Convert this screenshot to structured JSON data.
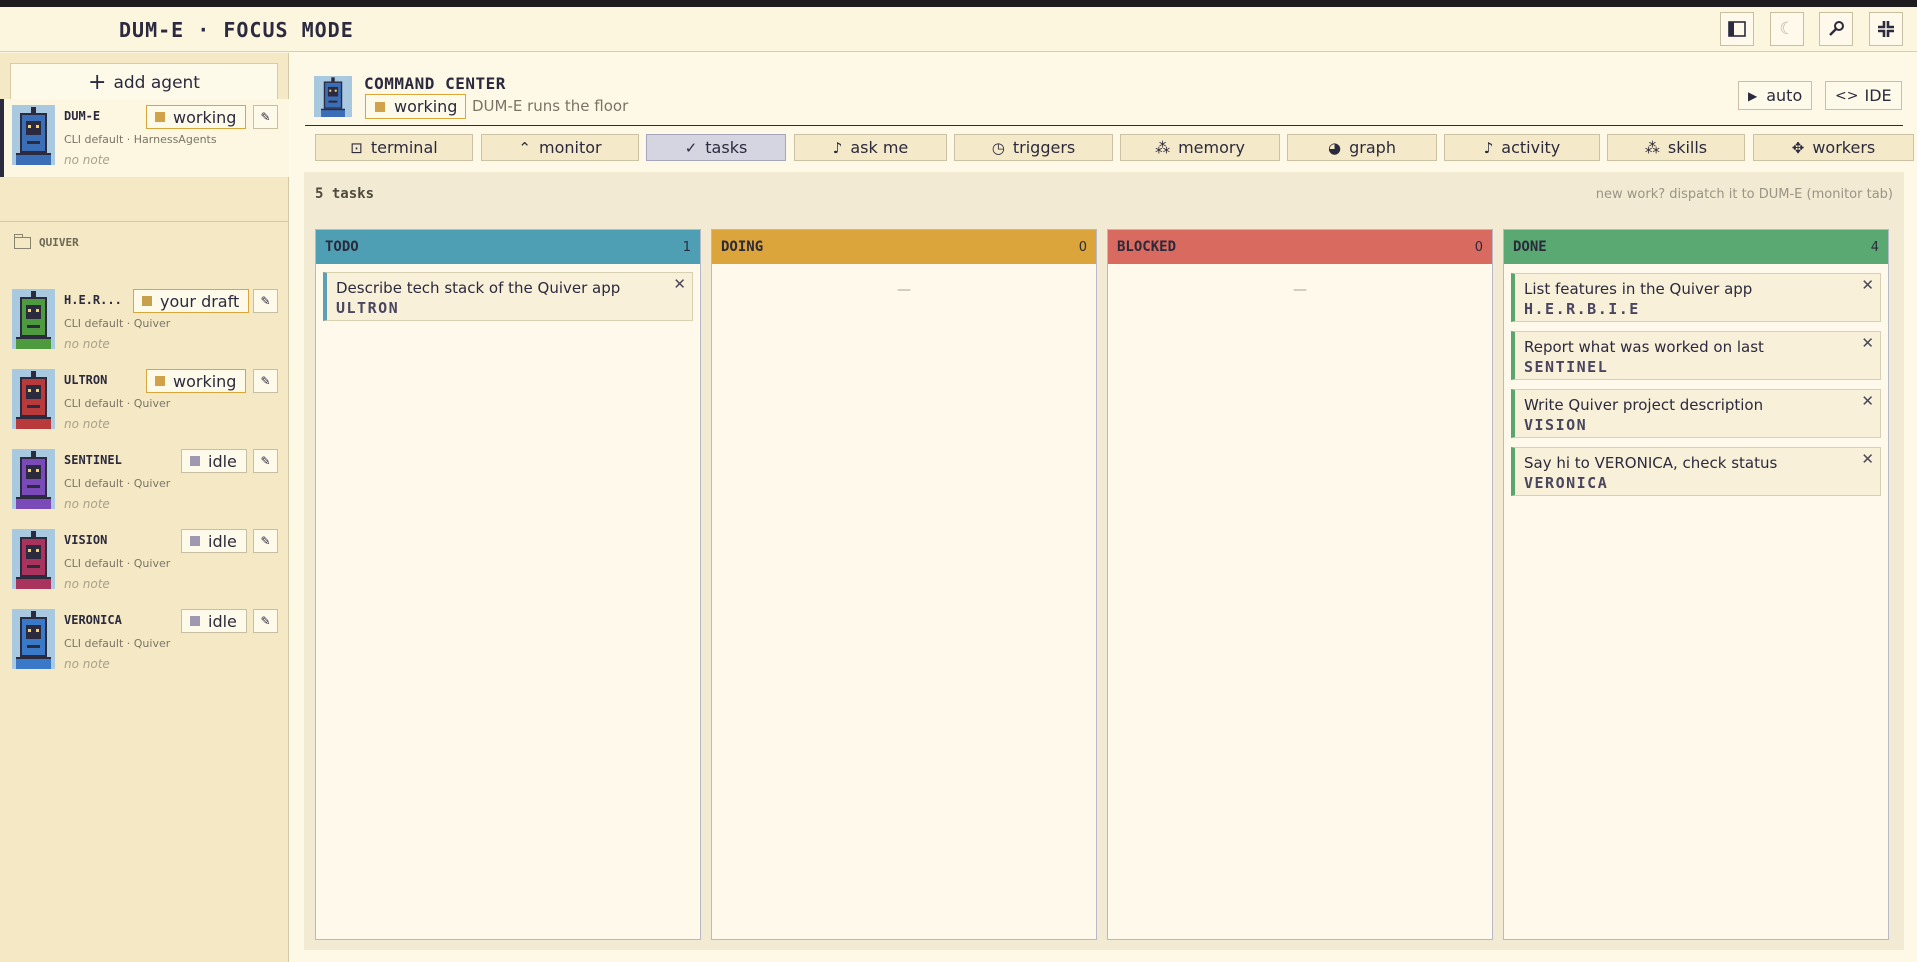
{
  "app": {
    "title": "DUM-E · FOCUS MODE"
  },
  "titlebar_buttons": [
    {
      "name": "sidebar-toggle-icon",
      "glyph": "◧"
    },
    {
      "name": "moon-icon",
      "glyph": "☾"
    },
    {
      "name": "wrench-icon",
      "glyph": "✎"
    },
    {
      "name": "focus-icon",
      "glyph": "✜"
    }
  ],
  "sidebar": {
    "add_agent_label": "add agent",
    "group_label": "QUIVER",
    "agents": [
      {
        "name": "DUM-E",
        "status": "working",
        "cli": "CLI default",
        "project": "HarnessAgents",
        "note": "no note",
        "color": "#3a6fb8"
      },
      {
        "name": "H.E.R...",
        "status": "your draft",
        "cli": "CLI default",
        "project": "Quiver",
        "note": "no note",
        "color": "#4e9a3e"
      },
      {
        "name": "ULTRON",
        "status": "working",
        "cli": "CLI default",
        "project": "Quiver",
        "note": "no note",
        "color": "#b83a3a"
      },
      {
        "name": "SENTINEL",
        "status": "idle",
        "cli": "CLI default",
        "project": "Quiver",
        "note": "no note",
        "color": "#7a4ab8"
      },
      {
        "name": "VISION",
        "status": "idle",
        "cli": "CLI default",
        "project": "Quiver",
        "note": "no note",
        "color": "#a8345e"
      },
      {
        "name": "VERONICA",
        "status": "idle",
        "cli": "CLI default",
        "project": "Quiver",
        "note": "no note",
        "color": "#3a78c8"
      }
    ],
    "meta_separator": "·"
  },
  "header": {
    "title": "COMMAND CENTER",
    "status": "working",
    "subtitle": "DUM-E runs the floor",
    "auto_label": "auto",
    "ide_label": "IDE"
  },
  "tabs": [
    {
      "label": "terminal",
      "icon": "⊡"
    },
    {
      "label": "monitor",
      "icon": "⌃"
    },
    {
      "label": "tasks",
      "icon": "✓",
      "active": true
    },
    {
      "label": "ask me",
      "icon": "♪"
    },
    {
      "label": "triggers",
      "icon": "◷"
    },
    {
      "label": "memory",
      "icon": "⁂"
    },
    {
      "label": "graph",
      "icon": "◕"
    },
    {
      "label": "activity",
      "icon": "♪"
    },
    {
      "label": "skills",
      "icon": "⁂"
    },
    {
      "label": "workers",
      "icon": "✥"
    }
  ],
  "tasks": {
    "count_label": "5 tasks",
    "hint": "new work? dispatch it to DUM-E (monitor tab)",
    "columns": [
      {
        "title": "TODO",
        "count": "1",
        "color": "#4e9fb3",
        "cards": [
          {
            "text": "Describe tech stack of the Quiver app",
            "agent": "ULTRON"
          }
        ]
      },
      {
        "title": "DOING",
        "count": "0",
        "color": "#dba53b",
        "empty": "—",
        "cards": []
      },
      {
        "title": "BLOCKED",
        "count": "0",
        "color": "#d96a60",
        "empty": "—",
        "cards": []
      },
      {
        "title": "DONE",
        "count": "4",
        "color": "#5aa872",
        "cards": [
          {
            "text": "List features in the Quiver app",
            "agent": "H.E.R.B.I.E"
          },
          {
            "text": "Report what was worked on last",
            "agent": "SENTINEL"
          },
          {
            "text": "Write Quiver project description",
            "agent": "VISION"
          },
          {
            "text": "Say hi to VERONICA, check status",
            "agent": "VERONICA"
          }
        ]
      }
    ]
  },
  "colors": {
    "working": "#d1a24a",
    "draft": "#c6a04a",
    "idle": "#9e98b0"
  }
}
